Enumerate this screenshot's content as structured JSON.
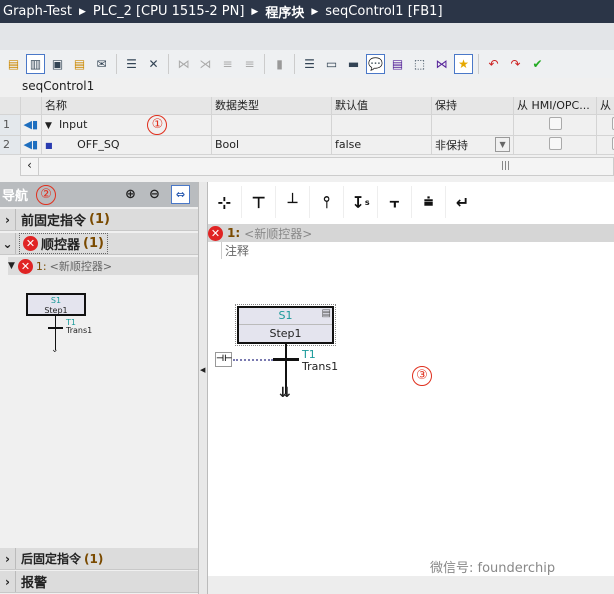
{
  "breadcrumb": [
    "Graph-Test",
    "PLC_2 [CPU 1515-2 PN]",
    "程序块",
    "seqControl1 [FB1]"
  ],
  "block_name": "seqControl1",
  "table": {
    "headers": [
      "名称",
      "数据类型",
      "默认值",
      "保持",
      "从 HMI/OPC...",
      "从 H"
    ],
    "rows": [
      {
        "num": "1",
        "name": "Input",
        "type": "",
        "default": "",
        "retain": ""
      },
      {
        "num": "2",
        "name": "OFF_SQ",
        "type": "Bool",
        "default": "false",
        "retain": "非保持"
      }
    ]
  },
  "annotations": {
    "one": "①",
    "two": "②",
    "three": "③"
  },
  "nav": {
    "title": "导航",
    "items": [
      {
        "label": "前固定指令",
        "count": "(1)"
      },
      {
        "label": "顺控器",
        "count": "(1)"
      },
      {
        "label": "后固定指令",
        "count": "(1)"
      },
      {
        "label": "报警"
      }
    ],
    "sub_item": {
      "num": "1:",
      "label": "<新顺控器>"
    }
  },
  "sequence": {
    "number": "1:",
    "name": "<新顺控器>",
    "comment": "注释",
    "step": {
      "id": "S1",
      "name": "Step1"
    },
    "transition": {
      "id": "T1",
      "name": "Trans1"
    }
  },
  "watermark": "微信号: founderchip",
  "colors": {
    "title_bg": "#2b3547",
    "error": "#e02424",
    "annotation": "#e0301e",
    "step_id": "#1a9a9a"
  }
}
